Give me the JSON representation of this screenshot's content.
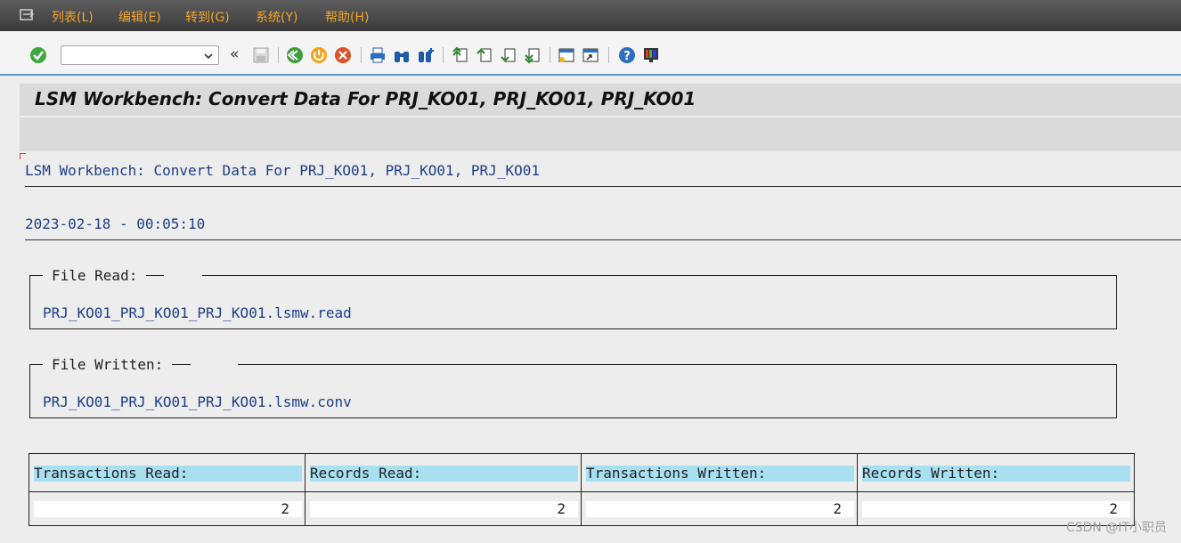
{
  "menu": {
    "items": [
      {
        "label": "列表(L)"
      },
      {
        "label": "编辑(E)"
      },
      {
        "label": "转到(G)"
      },
      {
        "label": "系统(Y)"
      },
      {
        "label": "帮助(H)"
      }
    ]
  },
  "toolbar": {
    "command_field_value": "",
    "nav_back_label": "«"
  },
  "title": "LSM Workbench: Convert Data For PRJ_KO01, PRJ_KO01, PRJ_KO01",
  "content": {
    "heading": "LSM Workbench: Convert Data For PRJ_KO01, PRJ_KO01, PRJ_KO01",
    "timestamp": "2023-02-18 - 00:05:10",
    "file_read": {
      "label": "File Read:",
      "value": "PRJ_KO01_PRJ_KO01_PRJ_KO01.lsmw.read"
    },
    "file_written": {
      "label": "File Written:",
      "value": "PRJ_KO01_PRJ_KO01_PRJ_KO01.lsmw.conv"
    },
    "stats": [
      {
        "label": "Transactions Read:",
        "value": "2"
      },
      {
        "label": "Records Read:",
        "value": "2"
      },
      {
        "label": "Transactions Written:",
        "value": "2"
      },
      {
        "label": "Records Written:",
        "value": "2"
      }
    ]
  },
  "watermark": "CSDN @IT小职员",
  "colors": {
    "menu_text": "#f0a42a",
    "content_text": "#1d3f86",
    "label_bg": "#a8e0f2",
    "toolbar_accent": "#5a98c4"
  }
}
